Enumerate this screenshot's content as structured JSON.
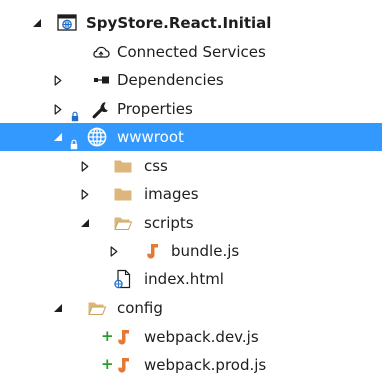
{
  "tree": {
    "project": "SpyStore.React.Initial",
    "connected_services": "Connected Services",
    "dependencies": "Dependencies",
    "properties": "Properties",
    "wwwroot": "wwwroot",
    "css": "css",
    "images": "images",
    "scripts": "scripts",
    "bundle_js": "bundle.js",
    "index_html": "index.html",
    "config": "config",
    "webpack_dev": "webpack.dev.js",
    "webpack_prod": "webpack.prod.js",
    "pending_add_marker": "+"
  },
  "colors": {
    "selection": "#3399ff",
    "folder": "#dcb67a",
    "js_icon": "#e37933",
    "pending_add": "#2d9a2d"
  }
}
